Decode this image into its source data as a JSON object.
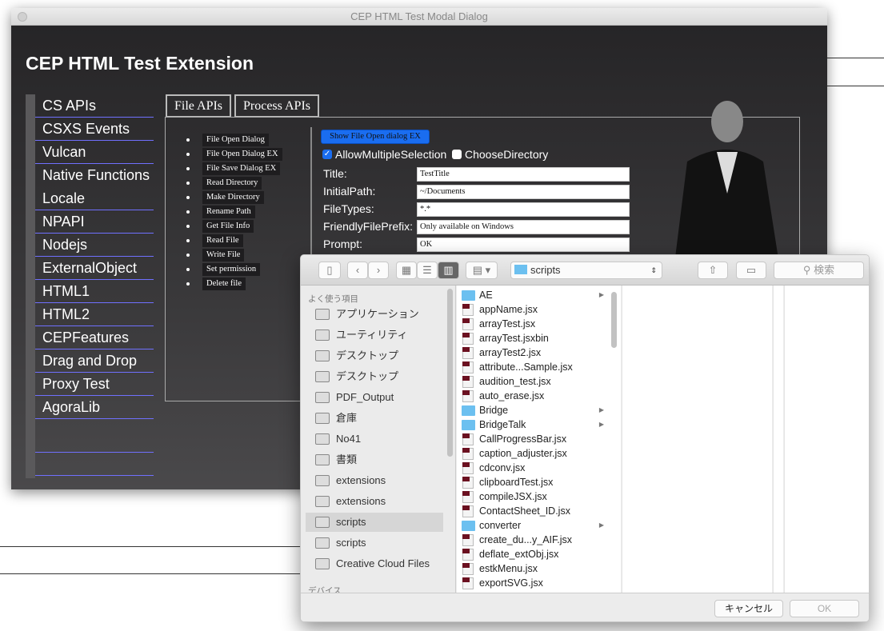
{
  "window": {
    "title": "CEP HTML Test Modal Dialog"
  },
  "app": {
    "title": "CEP HTML Test Extension"
  },
  "nav": [
    "CS APIs",
    "CSXS Events",
    "Vulcan",
    "Native Functions",
    "Locale",
    "NPAPI",
    "Nodejs",
    "ExternalObject",
    "HTML1",
    "HTML2",
    "CEPFeatures",
    "Drag and Drop",
    "Proxy Test",
    "AgoraLib",
    "",
    ""
  ],
  "tabs": [
    "File APIs",
    "Process APIs"
  ],
  "file_buttons": [
    "File Open Dialog",
    "File Open Dialog EX",
    "File Save Dialog EX",
    "Read Directory",
    "Make Directory",
    "Rename Path",
    "Get File Info",
    "Read File",
    "Write File",
    "Set permission",
    "Delete file"
  ],
  "show_button": "Show File Open dialog EX",
  "checkboxes": [
    {
      "label": "AllowMultipleSelection",
      "checked": true
    },
    {
      "label": "ChooseDirectory",
      "checked": false
    }
  ],
  "form": [
    {
      "label": "Title:",
      "value": "TestTitle"
    },
    {
      "label": "InitialPath:",
      "value": "~/Documents"
    },
    {
      "label": "FileTypes:",
      "value": "*.*"
    },
    {
      "label": "FriendlyFilePrefix:",
      "value": "Only available on Windows"
    },
    {
      "label": "Prompt:",
      "value": "OK"
    }
  ],
  "dialog": {
    "path": "scripts",
    "search_placeholder": "検索",
    "cancel": "キャンセル",
    "ok": "OK",
    "favorites_header": "よく使う項目",
    "devices_header": "デバイス",
    "sidebar": [
      {
        "label": "アプリケーション",
        "icon": "applications-icon"
      },
      {
        "label": "ユーティリティ",
        "icon": "folder-icon"
      },
      {
        "label": "デスクトップ",
        "icon": "desktop-icon"
      },
      {
        "label": "デスクトップ",
        "icon": "folder-icon"
      },
      {
        "label": "PDF_Output",
        "icon": "folder-icon"
      },
      {
        "label": "倉庫",
        "icon": "folder-icon"
      },
      {
        "label": "No41",
        "icon": "home-icon"
      },
      {
        "label": "書類",
        "icon": "documents-icon"
      },
      {
        "label": "extensions",
        "icon": "folder-icon"
      },
      {
        "label": "extensions",
        "icon": "folder-icon"
      },
      {
        "label": "scripts",
        "icon": "folder-icon",
        "selected": true
      },
      {
        "label": "scripts",
        "icon": "folder-icon"
      },
      {
        "label": "Creative Cloud Files",
        "icon": "creative-cloud-icon"
      }
    ],
    "files": [
      {
        "name": "AE",
        "folder": true
      },
      {
        "name": "appName.jsx"
      },
      {
        "name": "arrayTest.jsx"
      },
      {
        "name": "arrayTest.jsxbin"
      },
      {
        "name": "arrayTest2.jsx"
      },
      {
        "name": "attribute...Sample.jsx"
      },
      {
        "name": "audition_test.jsx"
      },
      {
        "name": "auto_erase.jsx"
      },
      {
        "name": "Bridge",
        "folder": true
      },
      {
        "name": "BridgeTalk",
        "folder": true
      },
      {
        "name": "CallProgressBar.jsx"
      },
      {
        "name": "caption_adjuster.jsx"
      },
      {
        "name": "cdconv.jsx"
      },
      {
        "name": "clipboardTest.jsx"
      },
      {
        "name": "compileJSX.jsx"
      },
      {
        "name": "ContactSheet_ID.jsx"
      },
      {
        "name": "converter",
        "folder": true
      },
      {
        "name": "create_du...y_AIF.jsx"
      },
      {
        "name": "deflate_extObj.jsx"
      },
      {
        "name": "estkMenu.jsx"
      },
      {
        "name": "exportSVG.jsx"
      }
    ]
  }
}
